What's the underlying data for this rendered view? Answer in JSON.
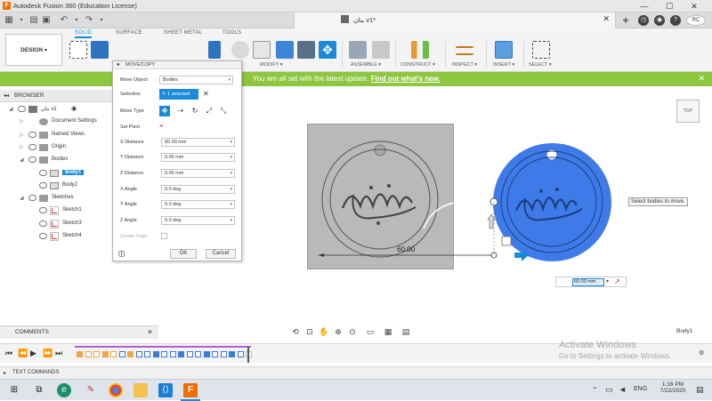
{
  "window": {
    "title": "Autodesk Fusion 360 (Education License)",
    "min": "—",
    "max": "☐",
    "close": "✕"
  },
  "doc_tab": {
    "label": "بنان v1*",
    "close": "✕",
    "user_initials": "RC"
  },
  "toolbar": {
    "workspace": "DESIGN",
    "workspace_tabs": [
      "SOLID",
      "SURFACE",
      "SHEET METAL",
      "TOOLS"
    ],
    "groups": [
      "MODIFY",
      "ASSEMBLE",
      "CONSTRUCT",
      "INSPECT",
      "INSERT",
      "SELECT"
    ]
  },
  "banner": {
    "message": "You are all set with the latest update.",
    "link": "Find out what's new.",
    "close": "✕"
  },
  "browser": {
    "title": "BROWSER",
    "items": [
      {
        "label": "بنان v1",
        "level": 0
      },
      {
        "label": "Document Settings",
        "level": 1
      },
      {
        "label": "Named Views",
        "level": 1
      },
      {
        "label": "Origin",
        "level": 1
      },
      {
        "label": "Bodies",
        "level": 1
      },
      {
        "label": "Body1",
        "level": 2
      },
      {
        "label": "Body2",
        "level": 2
      },
      {
        "label": "Sketches",
        "level": 1
      },
      {
        "label": "Sketch1",
        "level": 2
      },
      {
        "label": "Sketch3",
        "level": 2
      },
      {
        "label": "Sketch4",
        "level": 2
      }
    ]
  },
  "dialog": {
    "title": "MOVE/COPY",
    "move_object_label": "Move Object",
    "move_object_value": "Bodies",
    "selection_label": "Selection",
    "selection_value": "1 selected",
    "move_type_label": "Move Type",
    "set_pivot_label": "Set Pivot",
    "x_distance_label": "X Distance",
    "x_distance": "60.00 mm",
    "y_distance_label": "Y Distance",
    "y_distance": "0.00 mm",
    "z_distance_label": "Z Distance",
    "z_distance": "0.00 mm",
    "x_angle_label": "X Angle",
    "x_angle": "0.0 deg",
    "y_angle_label": "Y Angle",
    "y_angle": "0.0 deg",
    "z_angle_label": "Z Angle",
    "z_angle": "0.0 deg",
    "create_copy_label": "Create Copy",
    "ok": "OK",
    "cancel": "Cancel"
  },
  "canvas": {
    "dimension_value": "60.00",
    "tooltip": "Select bodies to move.",
    "input_value": "60.00 mm",
    "viewcube_label": "TOP",
    "selected_body": "Body1"
  },
  "bottom": {
    "comments": "COMMENTS",
    "text_commands": "TEXT COMMANDS",
    "activate_title": "Activate Windows",
    "activate_sub": "Go to Settings to activate Windows."
  },
  "taskbar": {
    "lang": "ENG",
    "time": "1:16 PM",
    "date": "7/22/2020"
  },
  "colors": {
    "accent": "#1a8bd8",
    "banner": "#8dc63f",
    "body_blue": "#3f7be8",
    "fusion_orange": "#f06c00"
  }
}
